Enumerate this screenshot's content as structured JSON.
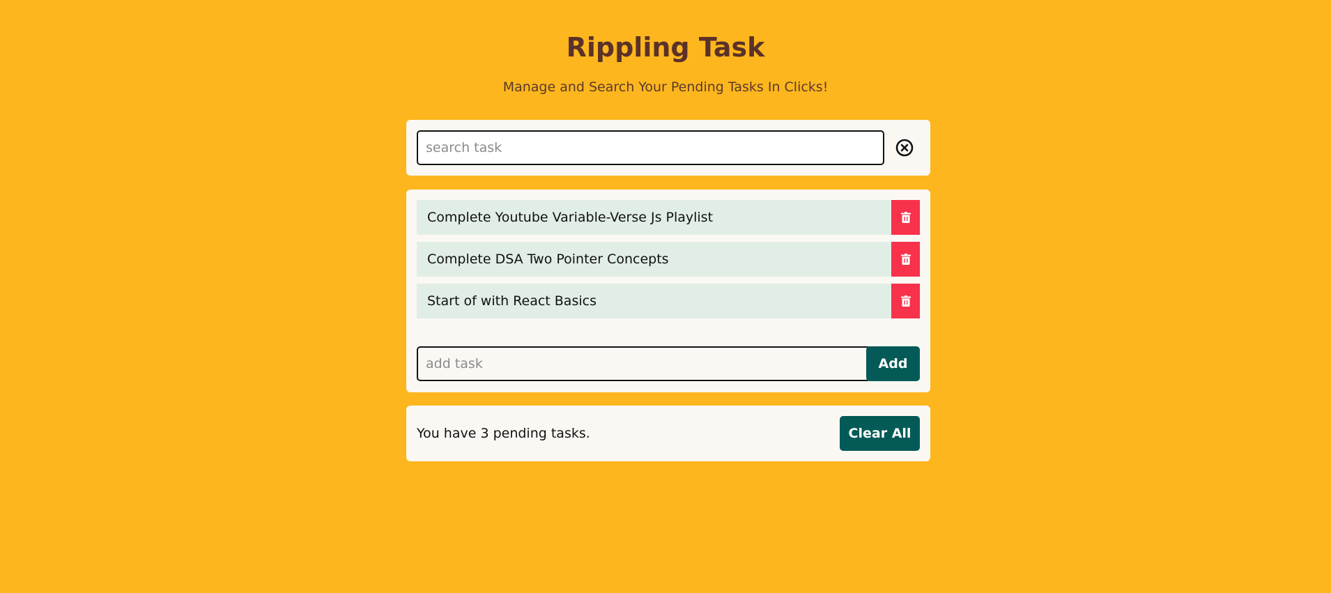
{
  "header": {
    "title": "Rippling Task",
    "subtitle": "Manage and Search Your Pending Tasks In Clicks!"
  },
  "search": {
    "placeholder": "search task",
    "value": "",
    "clear_icon": "close-circle-icon"
  },
  "tasks": [
    {
      "text": "Complete Youtube Variable-Verse Js Playlist",
      "delete_icon": "trash-icon"
    },
    {
      "text": "Complete DSA Two Pointer Concepts",
      "delete_icon": "trash-icon"
    },
    {
      "text": "Start of with React Basics",
      "delete_icon": "trash-icon"
    }
  ],
  "add_task": {
    "placeholder": "add task",
    "value": "",
    "button_label": "Add"
  },
  "footer": {
    "pending_text": "You have 3 pending tasks.",
    "clear_all_label": "Clear All"
  },
  "colors": {
    "background": "#FDB61E",
    "card": "#FBF8F4",
    "task_item": "#E1EEE6",
    "delete": "#F7324A",
    "primary_button": "#045A56",
    "title": "#5A3228"
  }
}
